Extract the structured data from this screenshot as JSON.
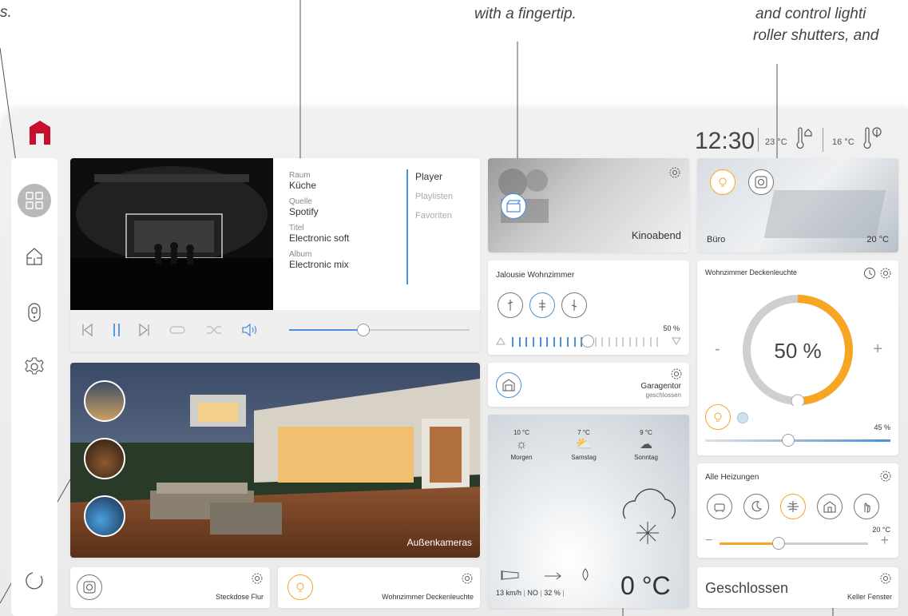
{
  "captions": {
    "left": "s.",
    "center": "with a fingertip.",
    "right_line1": "and control lighti",
    "right_line2": "roller shutters, and"
  },
  "header": {
    "time": "12:30",
    "indoor_temp": "23 °C",
    "outdoor_temp": "16 °C"
  },
  "sidebar": {
    "items": [
      {
        "name": "dashboard",
        "icon": "grid-icon",
        "active": true
      },
      {
        "name": "home",
        "icon": "house-icon"
      },
      {
        "name": "devices",
        "icon": "switch-icon"
      },
      {
        "name": "settings",
        "icon": "gear-icon"
      }
    ],
    "bottom_icon": "refresh-icon"
  },
  "player": {
    "room_label": "Raum",
    "room": "Küche",
    "source_label": "Quelle",
    "source": "Spotify",
    "title_label": "Titel",
    "title": "Electronic soft",
    "album_label": "Album",
    "album": "Electronic mix",
    "tabs": [
      "Player",
      "Playlisten",
      "Favoriten"
    ],
    "volume": 0.41,
    "accent": "#4a90d9"
  },
  "scene": {
    "label": "Kinoabend"
  },
  "blind": {
    "title": "Jalousie Wohnzimmer",
    "value": "50 %",
    "level": 0.5
  },
  "garage": {
    "title": "Garagentor",
    "status": "geschlossen"
  },
  "weather": {
    "days": [
      {
        "temp": "10 °C",
        "name": "Morgen",
        "icon": "sun-icon"
      },
      {
        "temp": "7 °C",
        "name": "Samstag",
        "icon": "sun-cloud-icon"
      },
      {
        "temp": "9 °C",
        "name": "Sonntag",
        "icon": "rain-cloud-icon"
      }
    ],
    "wind_speed": "13 km/h",
    "wind_dir": "NO",
    "humidity": "32 %",
    "current_temp": "0 °C"
  },
  "camera": {
    "label": "Außenkameras"
  },
  "office": {
    "label": "Büro",
    "temp": "20 °C"
  },
  "ceiling_light": {
    "title": "Wohnzimmer Deckenleuchte",
    "value": "50 %",
    "minus": "-",
    "plus": "+",
    "level": 0.5,
    "slider_value": "45 %",
    "slider_level": 0.45,
    "accent": "#f6a623"
  },
  "heating": {
    "title": "Alle Heizungen",
    "temp": "20 °C",
    "minus": "−",
    "plus": "+",
    "level": 0.4
  },
  "socket": {
    "label": "Steckdose Flur"
  },
  "ceiling_light_small": {
    "label": "Wohnzimmer Deckenleuchte"
  },
  "window": {
    "status": "Geschlossen",
    "label": "Keller Fenster"
  }
}
